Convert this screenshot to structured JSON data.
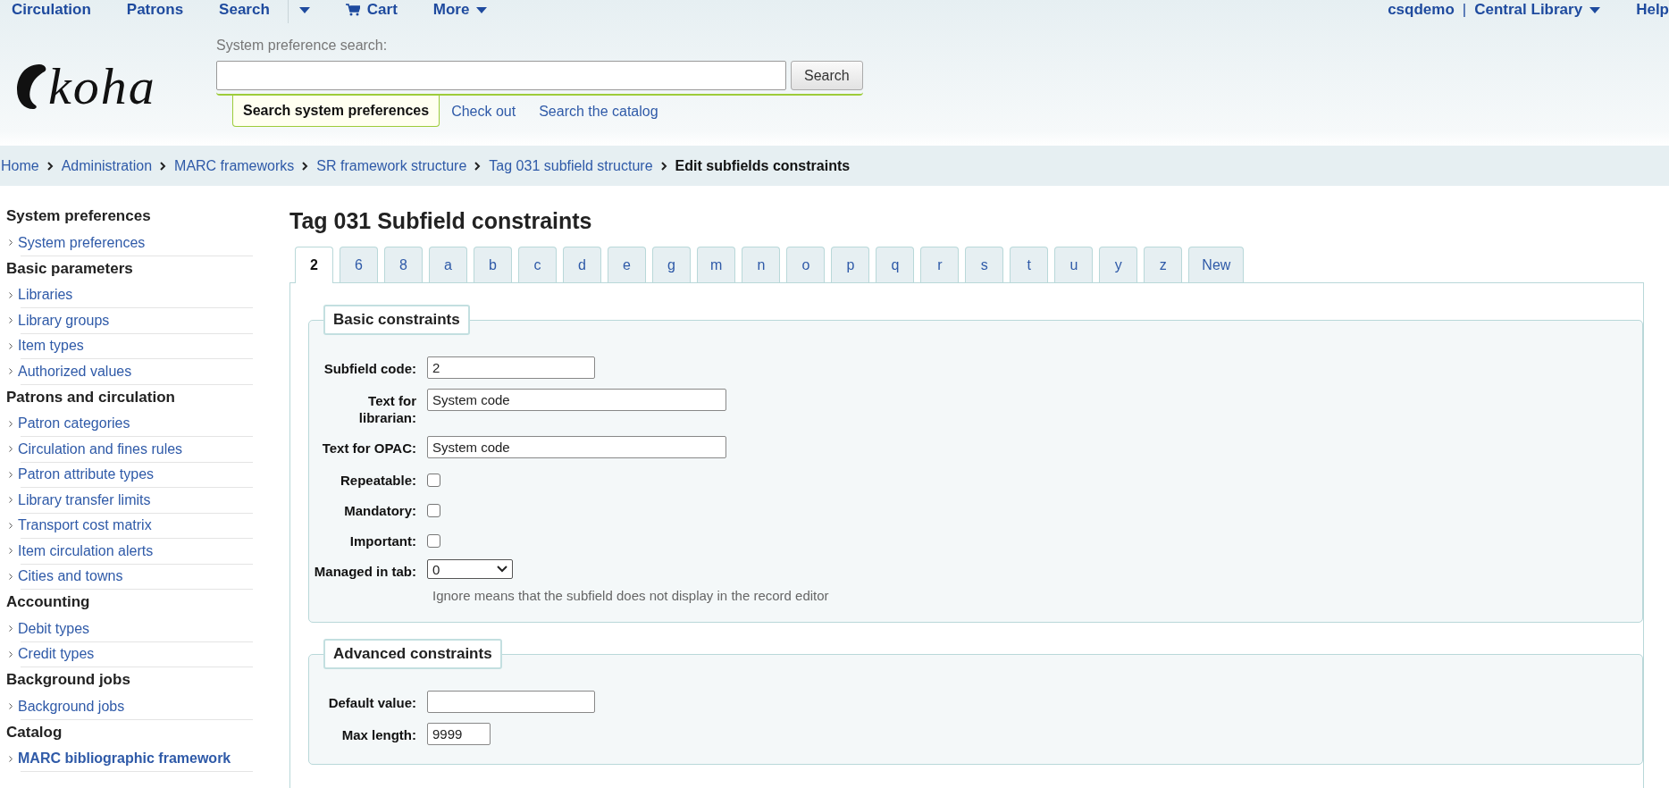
{
  "top_nav": {
    "left": [
      {
        "kind": "link",
        "label": "Circulation"
      },
      {
        "kind": "link",
        "label": "Patrons"
      },
      {
        "kind": "link",
        "label": "Search"
      },
      {
        "kind": "caret"
      },
      {
        "kind": "cart",
        "label": "Cart"
      },
      {
        "kind": "menu",
        "label": "More"
      }
    ],
    "user": "csqdemo",
    "separator": "|",
    "library": "Central Library",
    "help": "Help"
  },
  "header": {
    "logo_text": "koha",
    "search_label": "System preference search:",
    "search_button": "Search",
    "search_tabs": [
      {
        "label": "Search system preferences",
        "selected": true
      },
      {
        "label": "Check out",
        "selected": false
      },
      {
        "label": "Search the catalog",
        "selected": false
      }
    ]
  },
  "breadcrumbs": [
    {
      "label": "Home",
      "current": false
    },
    {
      "label": "Administration",
      "current": false
    },
    {
      "label": "MARC frameworks",
      "current": false
    },
    {
      "label": "SR framework structure",
      "current": false
    },
    {
      "label": "Tag 031 subfield structure",
      "current": false
    },
    {
      "label": "Edit subfields constraints",
      "current": true
    }
  ],
  "sidebar": [
    {
      "heading": "System preferences",
      "items": [
        {
          "label": "System preferences",
          "selected": false
        }
      ]
    },
    {
      "heading": "Basic parameters",
      "items": [
        {
          "label": "Libraries",
          "selected": false
        },
        {
          "label": "Library groups",
          "selected": false
        },
        {
          "label": "Item types",
          "selected": false
        },
        {
          "label": "Authorized values",
          "selected": false
        }
      ]
    },
    {
      "heading": "Patrons and circulation",
      "items": [
        {
          "label": "Patron categories",
          "selected": false
        },
        {
          "label": "Circulation and fines rules",
          "selected": false
        },
        {
          "label": "Patron attribute types",
          "selected": false
        },
        {
          "label": "Library transfer limits",
          "selected": false
        },
        {
          "label": "Transport cost matrix",
          "selected": false
        },
        {
          "label": "Item circulation alerts",
          "selected": false
        },
        {
          "label": "Cities and towns",
          "selected": false
        }
      ]
    },
    {
      "heading": "Accounting",
      "items": [
        {
          "label": "Debit types",
          "selected": false
        },
        {
          "label": "Credit types",
          "selected": false
        }
      ]
    },
    {
      "heading": "Background jobs",
      "items": [
        {
          "label": "Background jobs",
          "selected": false
        }
      ]
    },
    {
      "heading": "Catalog",
      "items": [
        {
          "label": "MARC bibliographic framework",
          "selected": true
        }
      ]
    }
  ],
  "title": "Tag 031 Subfield constraints",
  "subfield_tabs": [
    {
      "label": "2",
      "selected": true
    },
    {
      "label": "6",
      "selected": false
    },
    {
      "label": "8",
      "selected": false
    },
    {
      "label": "a",
      "selected": false
    },
    {
      "label": "b",
      "selected": false
    },
    {
      "label": "c",
      "selected": false
    },
    {
      "label": "d",
      "selected": false
    },
    {
      "label": "e",
      "selected": false
    },
    {
      "label": "g",
      "selected": false
    },
    {
      "label": "m",
      "selected": false
    },
    {
      "label": "n",
      "selected": false
    },
    {
      "label": "o",
      "selected": false
    },
    {
      "label": "p",
      "selected": false
    },
    {
      "label": "q",
      "selected": false
    },
    {
      "label": "r",
      "selected": false
    },
    {
      "label": "s",
      "selected": false
    },
    {
      "label": "t",
      "selected": false
    },
    {
      "label": "u",
      "selected": false
    },
    {
      "label": "y",
      "selected": false
    },
    {
      "label": "z",
      "selected": false
    },
    {
      "label": "New",
      "selected": false
    }
  ],
  "fieldsets": [
    {
      "legend": "Basic constraints",
      "fields": [
        {
          "kind": "code",
          "label": "Subfield code:",
          "value": "2"
        },
        {
          "kind": "text",
          "label": "Text for librarian:",
          "value": "System code"
        },
        {
          "kind": "text",
          "label": "Text for OPAC:",
          "value": "System code"
        },
        {
          "kind": "checkbox",
          "label": "Repeatable:",
          "checked": false
        },
        {
          "kind": "checkbox",
          "label": "Mandatory:",
          "checked": false
        },
        {
          "kind": "checkbox",
          "label": "Important:",
          "checked": false
        },
        {
          "kind": "select",
          "label": "Managed in tab:",
          "value": "0",
          "hint": "Ignore means that the subfield does not display in the record editor"
        }
      ]
    },
    {
      "legend": "Advanced constraints",
      "fields": [
        {
          "kind": "code",
          "label": "Default value:"
        },
        {
          "kind": "number",
          "label": "Max length:",
          "value": "9999"
        }
      ]
    }
  ]
}
